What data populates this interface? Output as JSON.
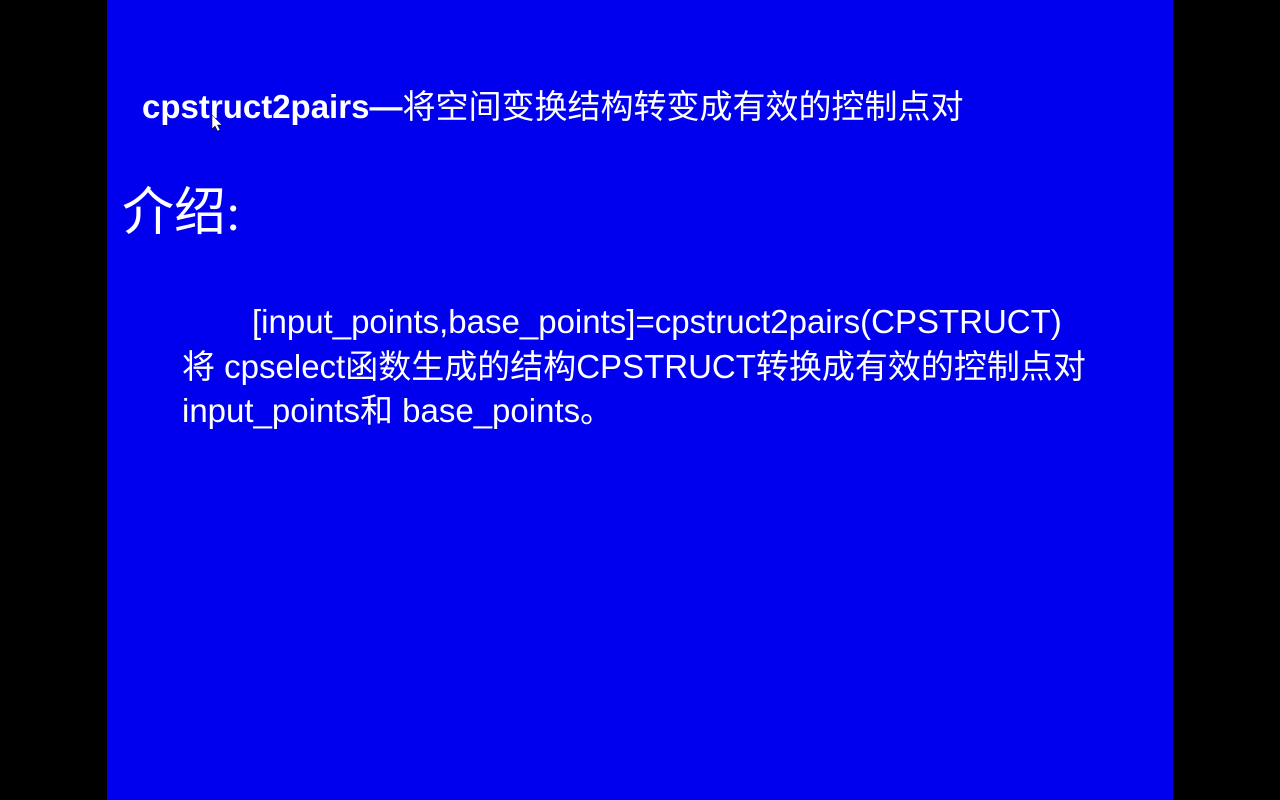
{
  "slide": {
    "title": {
      "function_name": "cpstruct2pairs",
      "dash": "—",
      "description": "将空间变换结构转变成有效的控制点对"
    },
    "heading": "介绍:",
    "body": {
      "line1": "[input_points,base_points]=cpstruct2pairs(CPSTRUCT)",
      "line2_part1": "将 cpselect函数生成的结构CPSTRUCT转换成有效的控制点对",
      "line3": "input_points和 base_points。"
    }
  },
  "cursor": {
    "type": "arrow"
  }
}
